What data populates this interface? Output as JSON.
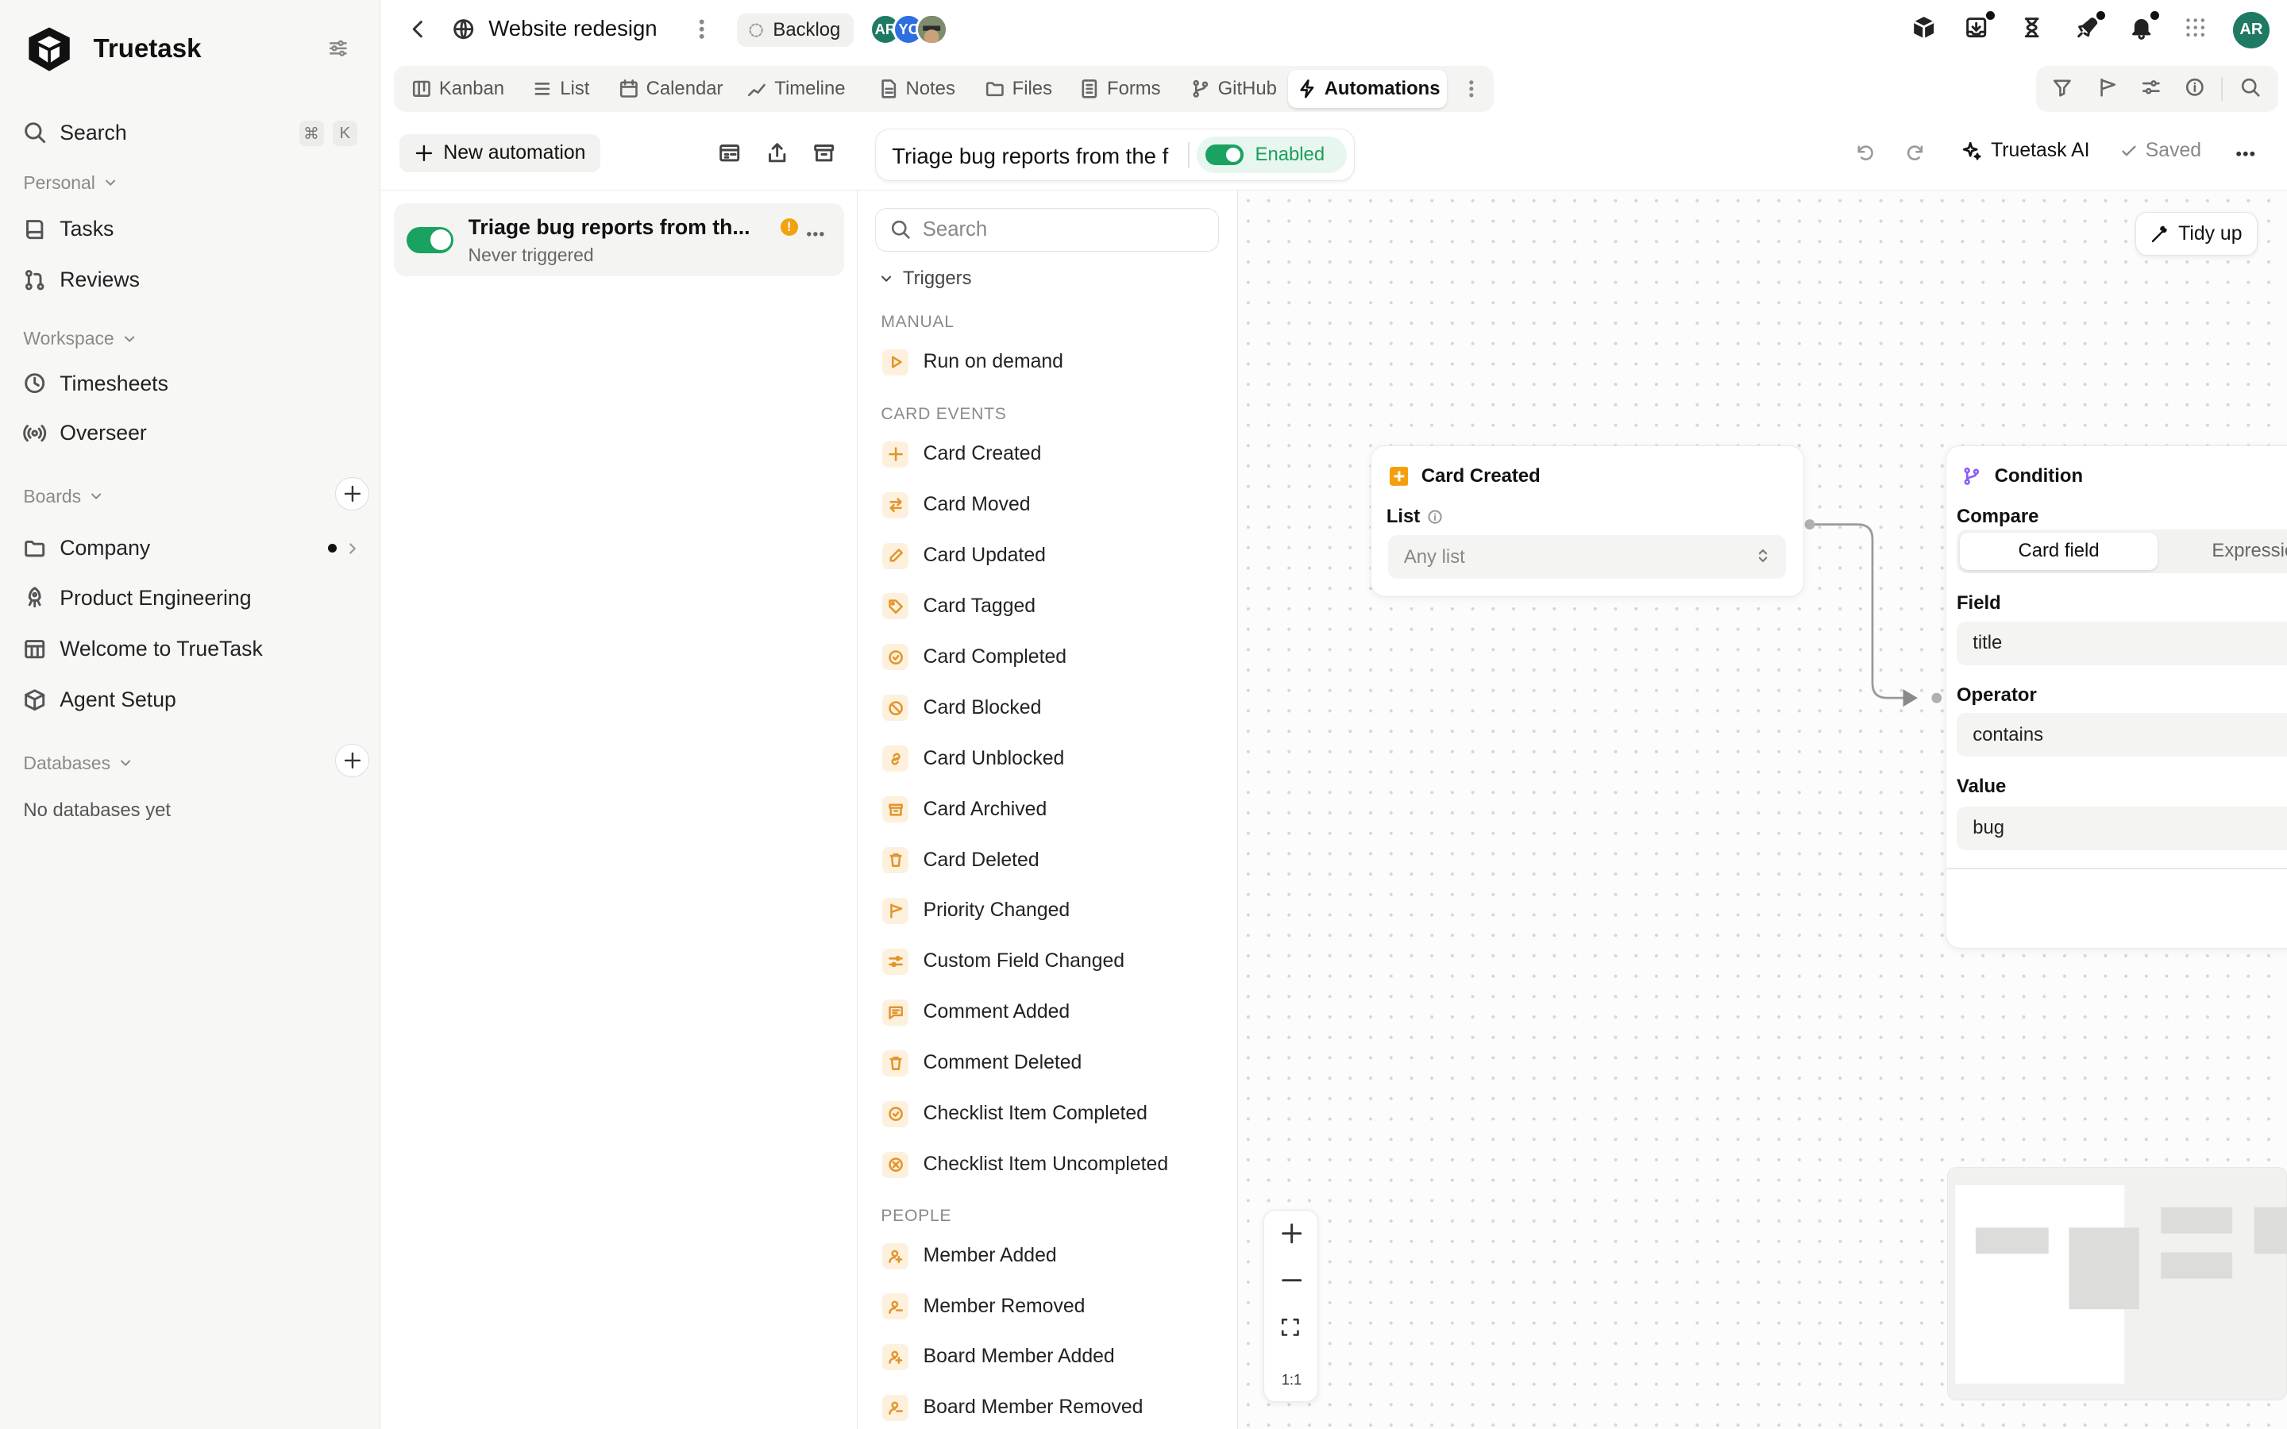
{
  "sidebar": {
    "brand": "Truetask",
    "search": {
      "label": "Search",
      "shortcut": [
        "⌘",
        "K"
      ]
    },
    "personal": {
      "label": "Personal",
      "items": [
        {
          "label": "Tasks"
        },
        {
          "label": "Reviews"
        }
      ]
    },
    "workspace": {
      "label": "Workspace",
      "items": [
        {
          "label": "Timesheets"
        },
        {
          "label": "Overseer"
        }
      ]
    },
    "boards": {
      "label": "Boards",
      "items": [
        {
          "label": "Company"
        },
        {
          "label": "Product Engineering"
        },
        {
          "label": "Welcome to TrueTask"
        },
        {
          "label": "Agent Setup"
        }
      ]
    },
    "databases": {
      "label": "Databases",
      "empty": "No databases yet"
    }
  },
  "header": {
    "title": "Website redesign",
    "backlog": "Backlog",
    "avatars": [
      {
        "initials": "AR",
        "color": "#1e7a63"
      },
      {
        "initials": "YC",
        "color": "#2d6ee0"
      },
      {
        "initials": "",
        "color": "#6b7a5c"
      }
    ],
    "me": "AR"
  },
  "tabs": [
    {
      "label": "Kanban",
      "icon": "kanban-icon"
    },
    {
      "label": "List",
      "icon": "list-icon"
    },
    {
      "label": "Calendar",
      "icon": "calendar-icon"
    },
    {
      "label": "Timeline",
      "icon": "timeline-icon"
    },
    {
      "label": "Notes",
      "icon": "notes-icon"
    },
    {
      "label": "Files",
      "icon": "folder-icon"
    },
    {
      "label": "Forms",
      "icon": "form-icon"
    },
    {
      "label": "GitHub",
      "icon": "branch-icon"
    },
    {
      "label": "Automations",
      "icon": "bolt-icon",
      "active": true
    }
  ],
  "toolbar": {
    "new_automation": "New automation",
    "automation_name": "Triage bug reports from the f",
    "status": "Enabled",
    "ai": "Truetask AI",
    "saved": "Saved"
  },
  "automations": [
    {
      "title": "Triage bug reports from th...",
      "subtitle": "Never triggered",
      "enabled": true,
      "warning": "!"
    }
  ],
  "palette": {
    "search_placeholder": "Search",
    "triggers_label": "Triggers",
    "groups": {
      "manual": "MANUAL",
      "card_events": "CARD EVENTS",
      "people": "PEOPLE"
    },
    "manual": [
      "Run on demand"
    ],
    "card_events": [
      "Card Created",
      "Card Moved",
      "Card Updated",
      "Card Tagged",
      "Card Completed",
      "Card Blocked",
      "Card Unblocked",
      "Card Archived",
      "Card Deleted",
      "Priority Changed",
      "Custom Field Changed",
      "Comment Added",
      "Comment Deleted",
      "Checklist Item Completed",
      "Checklist Item Uncompleted"
    ],
    "people": [
      "Member Added",
      "Member Removed",
      "Board Member Added",
      "Board Member Removed"
    ]
  },
  "canvas": {
    "tidy": "Tidy up",
    "trigger_node": {
      "title": "Card Created",
      "list_label": "List",
      "list_value": "Any list"
    },
    "condition_node": {
      "title": "Condition",
      "compare_label": "Compare",
      "compare_options": [
        "Card field",
        "Expression"
      ],
      "field_label": "Field",
      "field_value": "title",
      "operator_label": "Operator",
      "operator_value": "contains",
      "value_label": "Value",
      "value_value": "bug"
    },
    "zoom_reset": "1:1"
  }
}
